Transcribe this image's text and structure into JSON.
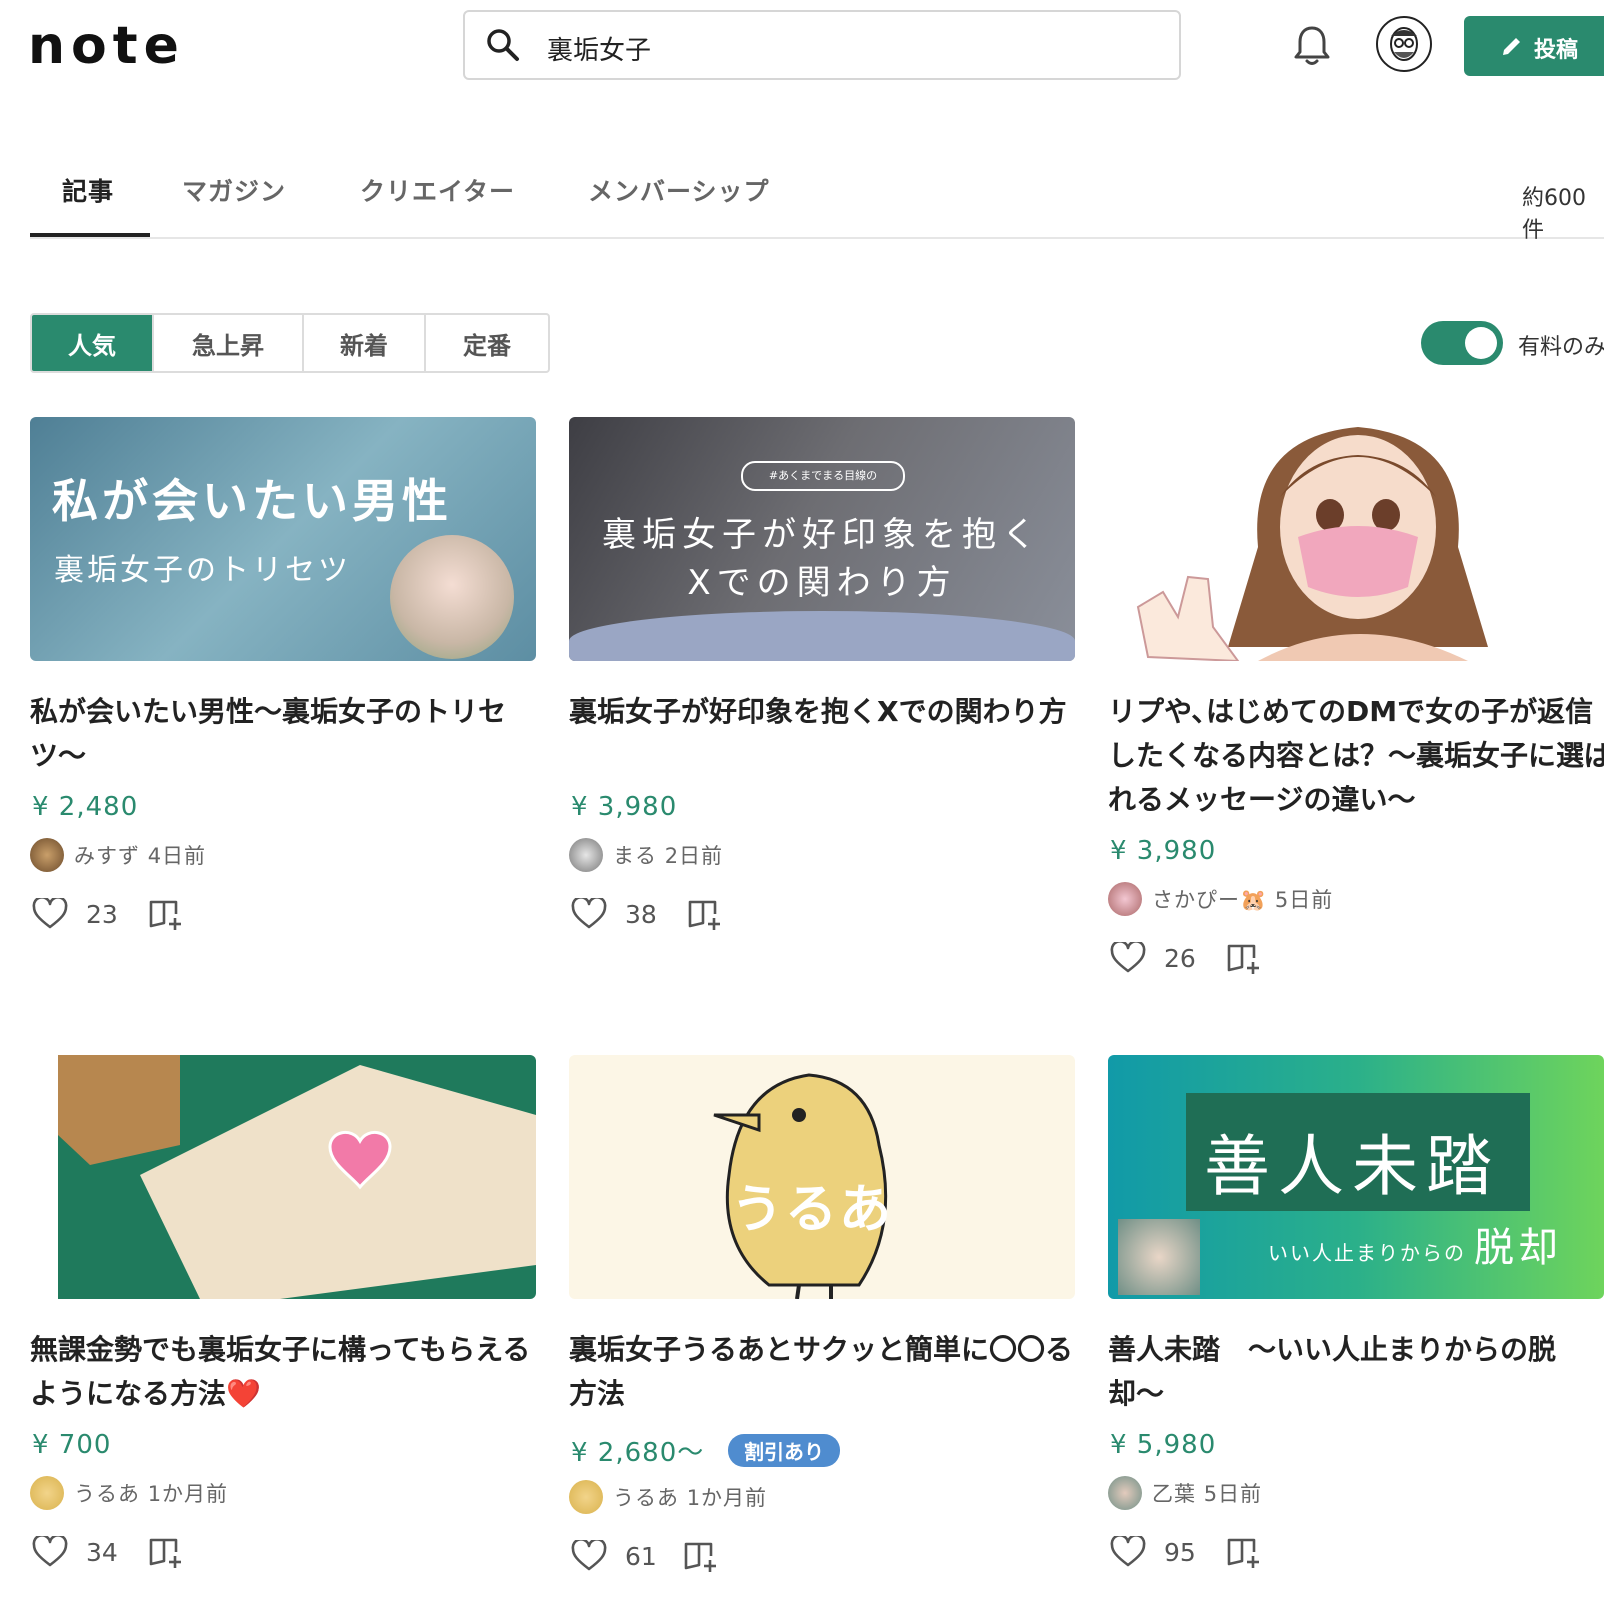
{
  "header": {
    "logo": "note",
    "search_value": "裏垢女子",
    "post_label": "投稿"
  },
  "tabs": [
    {
      "label": "記事"
    },
    {
      "label": "マガジン"
    },
    {
      "label": "クリエイター"
    },
    {
      "label": "メンバーシップ"
    }
  ],
  "result_count": "約600件",
  "sort": [
    "人気",
    "急上昇",
    "新着",
    "定番"
  ],
  "paid_only_label": "有料のみ",
  "colors": {
    "accent": "#2a8a6e",
    "badge": "#4f8ccf"
  },
  "cards": [
    {
      "thumb_text1": "私が会いたい男性",
      "thumb_text2": "裏垢女子のトリセツ",
      "title": "私が会いたい男性〜裏垢女子のトリセツ〜",
      "price": "¥ 2,480",
      "author": "みすず",
      "time": "4日前",
      "likes": "23"
    },
    {
      "thumb_tag": "#あくまでまる目線の",
      "thumb_text1": "裏垢女子が好印象を抱く",
      "thumb_text2": "Xでの関わり方",
      "title": "裏垢女子が好印象を抱くXでの関わり方",
      "price": "¥ 3,980",
      "author": "まる",
      "time": "2日前",
      "likes": "38"
    },
    {
      "title": "リプや､はじめてのDMで女の子が返信したくなる内容とは？〜裏垢女子に選ばれるメッセージの違い〜",
      "price": "¥ 3,980",
      "author": "さかぴー🐹",
      "time": "5日前",
      "likes": "26"
    },
    {
      "title": "無課金勢でも裏垢女子に構ってもらえるようになる方法❤️",
      "price": "¥ 700",
      "author": "うるあ",
      "time": "1か月前",
      "likes": "34"
    },
    {
      "thumb_text1": "うるあ",
      "title": "裏垢女子うるあとサクッと簡単に〇〇る方法",
      "price": "¥ 2,680〜",
      "badge": "割引あり",
      "author": "うるあ",
      "time": "1か月前",
      "likes": "61"
    },
    {
      "thumb_text1": "善人未踏",
      "thumb_text2": "いい人止まりからの",
      "thumb_text3": "脱却",
      "title": "善人未踏　〜いい人止まりからの脱却〜",
      "price": "¥ 5,980",
      "author": "乙葉",
      "time": "5日前",
      "likes": "95"
    }
  ]
}
